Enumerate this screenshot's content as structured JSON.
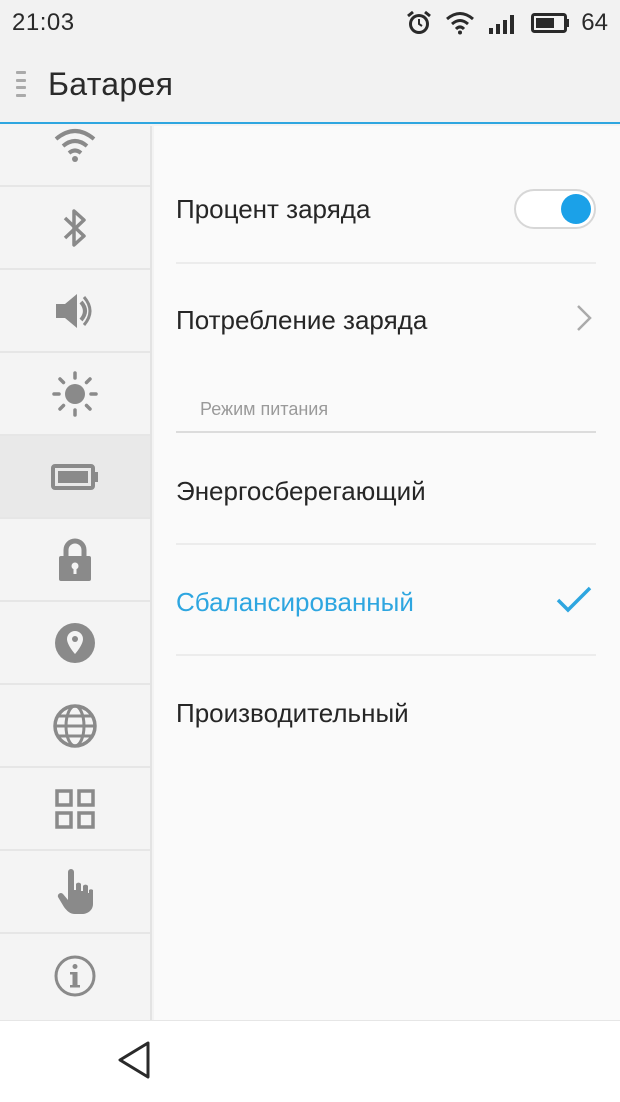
{
  "status_bar": {
    "time": "21:03",
    "battery_level": "64",
    "icons": [
      "alarm-icon",
      "wifi-icon",
      "signal-icon",
      "battery-icon"
    ]
  },
  "header": {
    "title": "Батарея",
    "menu_icon": "drawer-handle-icon"
  },
  "sidebar": {
    "items": [
      {
        "icon": "wifi-icon",
        "active": false
      },
      {
        "icon": "bluetooth-icon",
        "active": false
      },
      {
        "icon": "sound-icon",
        "active": false
      },
      {
        "icon": "brightness-icon",
        "active": false
      },
      {
        "icon": "battery-icon",
        "active": true
      },
      {
        "icon": "lock-icon",
        "active": false
      },
      {
        "icon": "location-icon",
        "active": false
      },
      {
        "icon": "globe-icon",
        "active": false
      },
      {
        "icon": "apps-grid-icon",
        "active": false
      },
      {
        "icon": "gesture-hand-icon",
        "active": false
      },
      {
        "icon": "info-icon",
        "active": false
      }
    ]
  },
  "settings": {
    "charge_percent": {
      "label": "Процент заряда",
      "enabled": true
    },
    "charge_usage": {
      "label": "Потребление заряда"
    },
    "power_mode_header": "Режим питания",
    "modes": [
      {
        "label": "Энергосберегающий",
        "selected": false
      },
      {
        "label": "Сбалансированный",
        "selected": true
      },
      {
        "label": "Производительный",
        "selected": false
      }
    ]
  },
  "colors": {
    "accent": "#2ea6e0",
    "toggle_on": "#1ba1e8",
    "icon_gray": "#8a8a8a"
  },
  "nav": {
    "back_icon": "back-triangle-icon"
  }
}
